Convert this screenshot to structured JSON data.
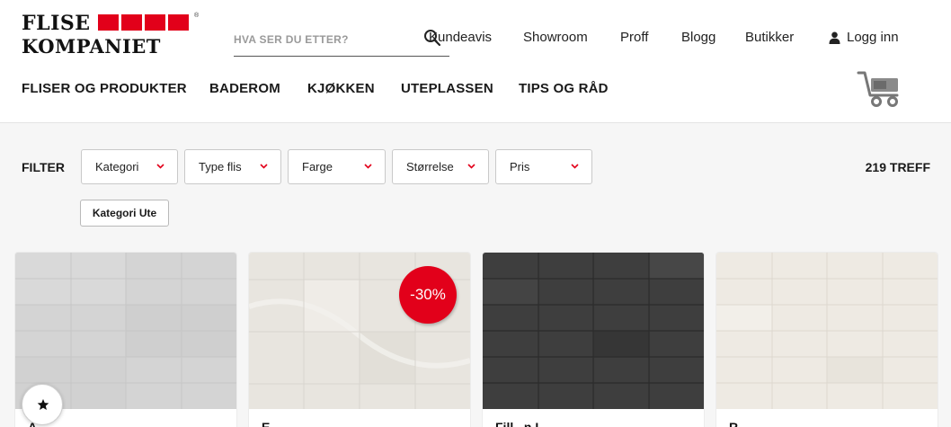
{
  "logo": {
    "line1": "FLISE",
    "line2": "KOMPANIET",
    "reg": "®"
  },
  "search": {
    "placeholder": "HVA SER DU ETTER?"
  },
  "topnav": [
    "Kundeavis",
    "Showroom",
    "Proff",
    "Blogg",
    "Butikker"
  ],
  "login_label": "Logg inn",
  "mainnav": [
    "FLISER OG PRODUKTER",
    "BADEROM",
    "KJØKKEN",
    "UTEPLASSEN",
    "TIPS OG RÅD"
  ],
  "filter": {
    "label": "FILTER",
    "dropdowns": [
      "Kategori",
      "Type flis",
      "Farge",
      "Størrelse",
      "Pris"
    ],
    "active_chip": "Kategori Ute",
    "hits": "219 TREFF"
  },
  "products": [
    {
      "name": "A...",
      "tile_color": "#d6d6d6"
    },
    {
      "name": "E...",
      "tile_color": "#e9e6e0",
      "badge": "-30%"
    },
    {
      "name": "Fjll...n L...",
      "tile_color": "#3f3f3f"
    },
    {
      "name": "R...",
      "tile_color": "#efebe4"
    }
  ],
  "colors": {
    "brand_red": "#e2001a"
  },
  "icons": {
    "search": "search-icon",
    "user": "user-icon",
    "cart": "cart-icon",
    "chevron": "chevron-down-icon",
    "favorite": "star-icon"
  }
}
